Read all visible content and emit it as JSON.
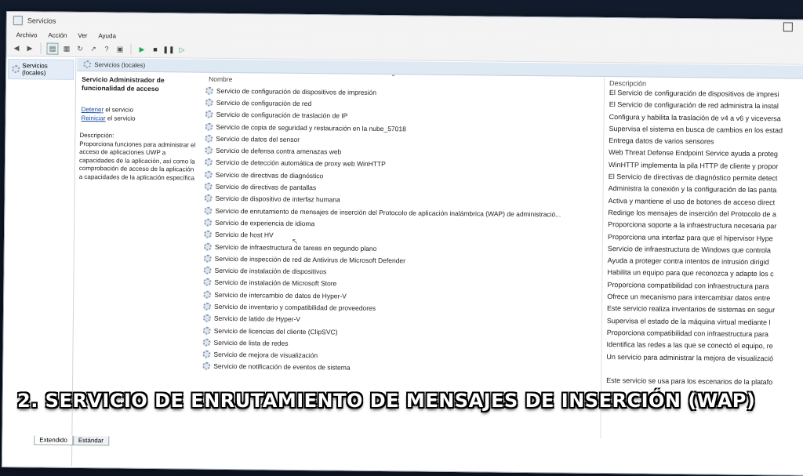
{
  "window": {
    "title": "Servicios"
  },
  "menu": [
    "Archivo",
    "Acción",
    "Ver",
    "Ayuda"
  ],
  "tree": {
    "root_label": "Servicios (locales)"
  },
  "pane": {
    "header": "Servicios (locales)"
  },
  "info": {
    "service_title": "Servicio Administrador de funcionalidad de acceso",
    "stop_link": "Detener",
    "stop_suffix": " el servicio",
    "restart_link": "Reiniciar",
    "restart_suffix": " el servicio",
    "description_label": "Descripción:",
    "description": "Proporciona funciones para administrar el acceso de aplicaciones UWP a capacidades de la aplicación, así como la comprobación de acceso de la aplicación a capacidades de la aplicación específica"
  },
  "columns": {
    "name": "Nombre",
    "description": "Descripción"
  },
  "services": [
    {
      "name": "Servicio de configuración de dispositivos de impresión",
      "desc": "El Servicio de configuración de dispositivos de impresi"
    },
    {
      "name": "Servicio de configuración de red",
      "desc": "El Servicio de configuración de red administra la instal"
    },
    {
      "name": "Servicio de configuración de traslación de IP",
      "desc": "Configura y habilita la traslación de v4 a v6 y viceversa"
    },
    {
      "name": "Servicio de copia de seguridad y restauración en la nube_57018",
      "desc": "Supervisa el sistema en busca de cambios en los estad"
    },
    {
      "name": "Servicio de datos del sensor",
      "desc": "Entrega datos de varios sensores"
    },
    {
      "name": "Servicio de defensa contra amenazas web",
      "desc": "Web Threat Defense Endpoint Service ayuda a proteg"
    },
    {
      "name": "Servicio de detección automática de proxy web WinHTTP",
      "desc": "WinHTTP implementa la pila HTTP de cliente y propor"
    },
    {
      "name": "Servicio de directivas de diagnóstico",
      "desc": "El Servicio de directivas de diagnóstico permite detect"
    },
    {
      "name": "Servicio de directivas de pantallas",
      "desc": "Administra la conexión y la configuración de las panta"
    },
    {
      "name": "Servicio de dispositivo de interfaz humana",
      "desc": "Activa y mantiene el uso de botones de acceso direct"
    },
    {
      "name": "Servicio de enrutamiento de mensajes de inserción del Protocolo de aplicación inalámbrica (WAP) de administració...",
      "desc": "Redirige los mensajes de inserción del Protocolo de a"
    },
    {
      "name": "Servicio de experiencia de idioma",
      "desc": "Proporciona soporte a la infraestructura necesaria par"
    },
    {
      "name": "Servicio de host HV",
      "desc": "Proporciona una interfaz para que el hipervisor Hype"
    },
    {
      "name": "Servicio de infraestructura de tareas en segundo plano",
      "desc": "Servicio de infraestructura de Windows que controla"
    },
    {
      "name": "Servicio de inspección de red de Antivirus de Microsoft Defender",
      "desc": "Ayuda a proteger contra intentos de intrusión dirigid"
    },
    {
      "name": "Servicio de instalación de dispositivos",
      "desc": "Habilita un equipo para que reconozca y adapte los c"
    },
    {
      "name": "Servicio de instalación de Microsoft Store",
      "desc": "Proporciona compatibilidad con infraestructura para"
    },
    {
      "name": "Servicio de intercambio de datos de Hyper-V",
      "desc": "Ofrece un mecanismo para intercambiar datos entre"
    },
    {
      "name": "Servicio de inventario y compatibilidad de proveedores",
      "desc": "Este servicio realiza inventarios de sistemas en segur"
    },
    {
      "name": "Servicio de latido de Hyper-V",
      "desc": "Supervisa el estado de la máquina virtual mediante l"
    },
    {
      "name": "Servicio de licencias del cliente (ClipSVC)",
      "desc": "Proporciona compatibilidad con infraestructura para"
    },
    {
      "name": "Servicio de lista de redes",
      "desc": "Identifica las redes a las que se conectó el equipo, re"
    },
    {
      "name": "Servicio de mejora de visualización",
      "desc": "Un servicio para administrar la mejora de visualizació"
    },
    {
      "name": "Servicio de notificación de eventos de sistema",
      "desc": ""
    }
  ],
  "extra_desc": [
    "Este servicio se usa para los escenarios de la platafo"
  ],
  "tabs": [
    "Extendido",
    "Estándar"
  ],
  "caption": "2. SERVICIO DE ENRUTAMIENTO DE MENSAJES DE INSERCIÓN (WAP)"
}
